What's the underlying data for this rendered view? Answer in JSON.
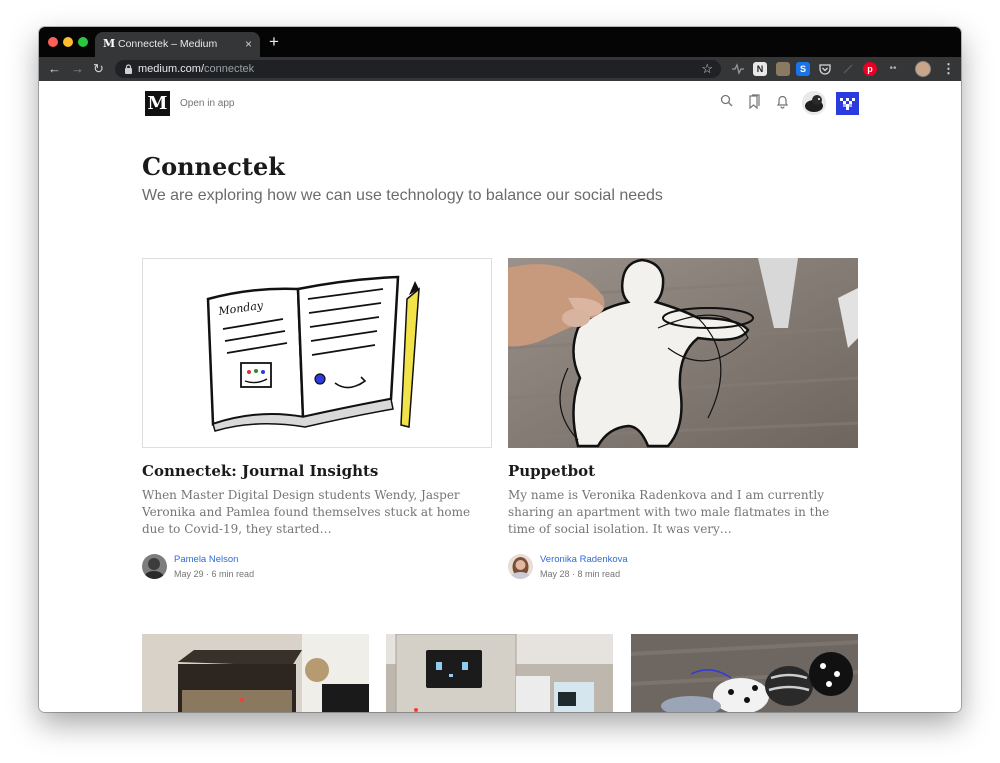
{
  "browser": {
    "tab": {
      "favicon": "M",
      "title": "Connectek – Medium",
      "close": "×"
    },
    "new_tab": "+",
    "nav": {
      "back": "←",
      "forward": "→",
      "reload": "↻"
    },
    "url": {
      "domain": "medium.com/",
      "path": "connectek"
    },
    "bookmark_star": "☆",
    "extensions": [
      "activity-icon",
      "notion-icon",
      "clipper-icon",
      "sheets-icon",
      "pocket-icon",
      "arrow-icon",
      "pinterest-icon",
      "dots-icon"
    ],
    "menu": "⋮"
  },
  "site": {
    "logo": "M",
    "open_in_app": "Open in app",
    "header_icons": [
      "search-icon",
      "bookmarks-icon",
      "bell-icon"
    ]
  },
  "publication": {
    "title": "Connectek",
    "description": "We are exploring how we can use technology to balance our social needs"
  },
  "posts": [
    {
      "title": "Connectek: Journal Insights",
      "excerpt": "When Master Digital Design students Wendy, Jasper Veronika and Pamlea found themselves stuck at home due to Covid-19, they started…",
      "author": "Pamela Nelson",
      "date": "May 29",
      "read_time": "6 min read",
      "image_text": "Monday"
    },
    {
      "title": "Puppetbot",
      "excerpt": "My name is Veronika Radenkova and I am currently sharing an apartment with two male flatmates in the time of social isolation. It was very…",
      "author": "Veronika Radenkova",
      "date": "May 28",
      "read_time": "8 min read"
    }
  ],
  "separator": "·",
  "colors": {
    "link": "#2f6bd6",
    "pub_icon": "#2c3be0",
    "tab_bar": "#050505",
    "toolbar": "#353638"
  }
}
